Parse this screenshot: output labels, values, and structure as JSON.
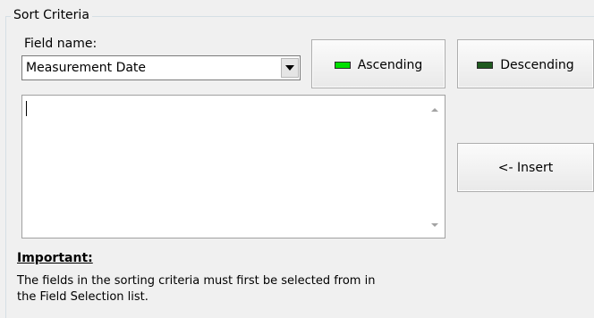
{
  "group": {
    "title": "Sort Criteria"
  },
  "field": {
    "label": "Field name:",
    "selected_value": "Measurement Date"
  },
  "buttons": {
    "ascending": "Ascending",
    "descending": "Descending",
    "insert": "<- Insert"
  },
  "criteria_text": {
    "value": ""
  },
  "note": {
    "heading": "Important:",
    "line1": "The fields in the sorting criteria must first be selected from in",
    "line2": "the Field Selection list."
  },
  "colors": {
    "ascending_led": "#00e000",
    "descending_led": "#1f5a1f",
    "background": "#f0f0f0"
  }
}
